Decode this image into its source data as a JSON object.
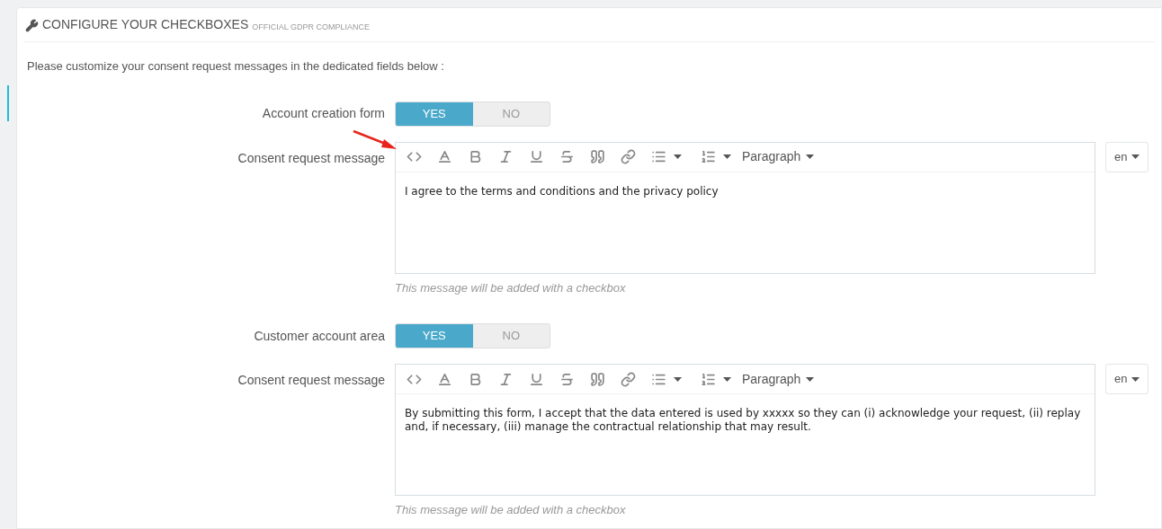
{
  "panel": {
    "title": "CONFIGURE YOUR CHECKBOXES",
    "subtitle": "OFFICIAL GDPR COMPLIANCE",
    "intro": "Please customize your consent request messages in the dedicated fields below :"
  },
  "sections": [
    {
      "switch": {
        "label": "Account creation form",
        "options": [
          {
            "label": "YES",
            "selected": true
          },
          {
            "label": "NO",
            "selected": false
          }
        ]
      },
      "editor": {
        "label": "Consent request message",
        "format": "Paragraph",
        "text": "I agree to the terms and conditions and the privacy policy",
        "language": "en",
        "hint": "This message will be added with a checkbox",
        "annotated": true
      }
    },
    {
      "switch": {
        "label": "Customer account area",
        "options": [
          {
            "label": "YES",
            "selected": true
          },
          {
            "label": "NO",
            "selected": false
          }
        ]
      },
      "editor": {
        "label": "Consent request message",
        "format": "Paragraph",
        "text": "By submitting this form, I accept that the data entered is used by xxxxx so they can (i) acknowledge your request, (ii) replay and, if necessary, (iii) manage the contractual relationship that may result.",
        "language": "en",
        "hint": "This message will be added with a checkbox",
        "annotated": false
      }
    }
  ]
}
